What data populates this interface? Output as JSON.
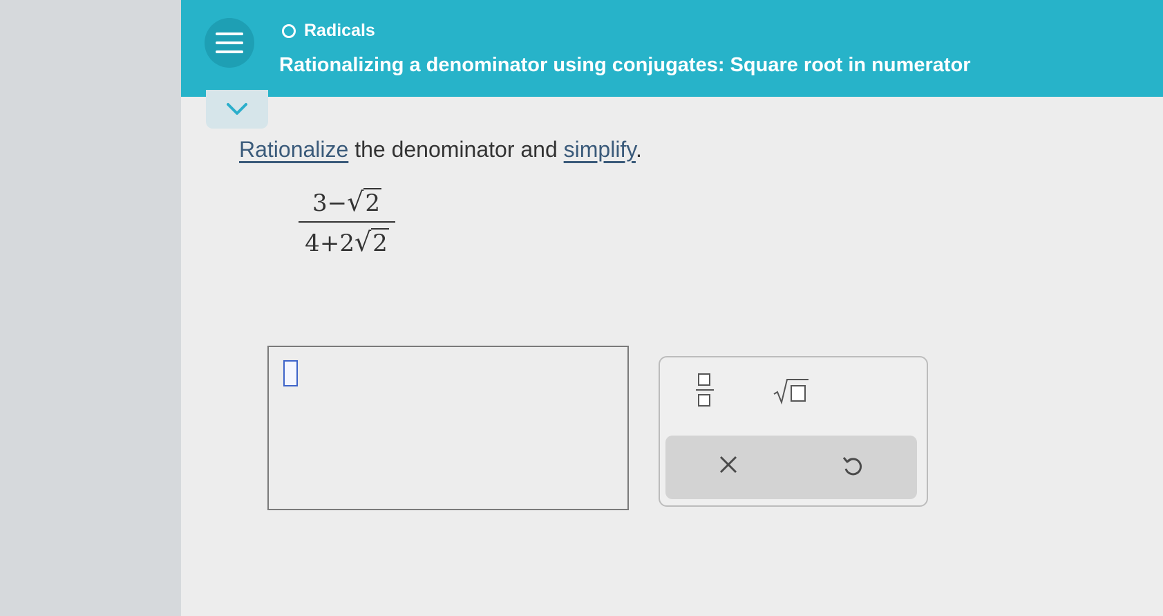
{
  "header": {
    "topic_label": "Radicals",
    "title": "Rationalizing a denominator using conjugates: Square root in numerator"
  },
  "problem": {
    "instruction_word_1": "Rationalize",
    "instruction_middle": " the denominator and ",
    "instruction_word_2": "simplify",
    "instruction_end": ".",
    "expression": {
      "numerator_whole": "3",
      "numerator_operator": "−",
      "numerator_radicand": "2",
      "denominator_whole": "4",
      "denominator_operator": "+",
      "denominator_coefficient": "2",
      "denominator_radicand": "2"
    }
  },
  "answer": {
    "value": ""
  },
  "palette": {
    "keys": [
      "fraction",
      "square-root"
    ],
    "actions": [
      "clear",
      "undo"
    ]
  },
  "icons": {
    "menu": "hamburger-icon",
    "topic": "circle-outline-icon",
    "collapse": "chevron-down-icon",
    "clear": "x-icon",
    "undo": "undo-icon"
  },
  "colors": {
    "header": "#27b3c9",
    "cursor": "#3d63c9",
    "link": "#3a5a7a"
  }
}
